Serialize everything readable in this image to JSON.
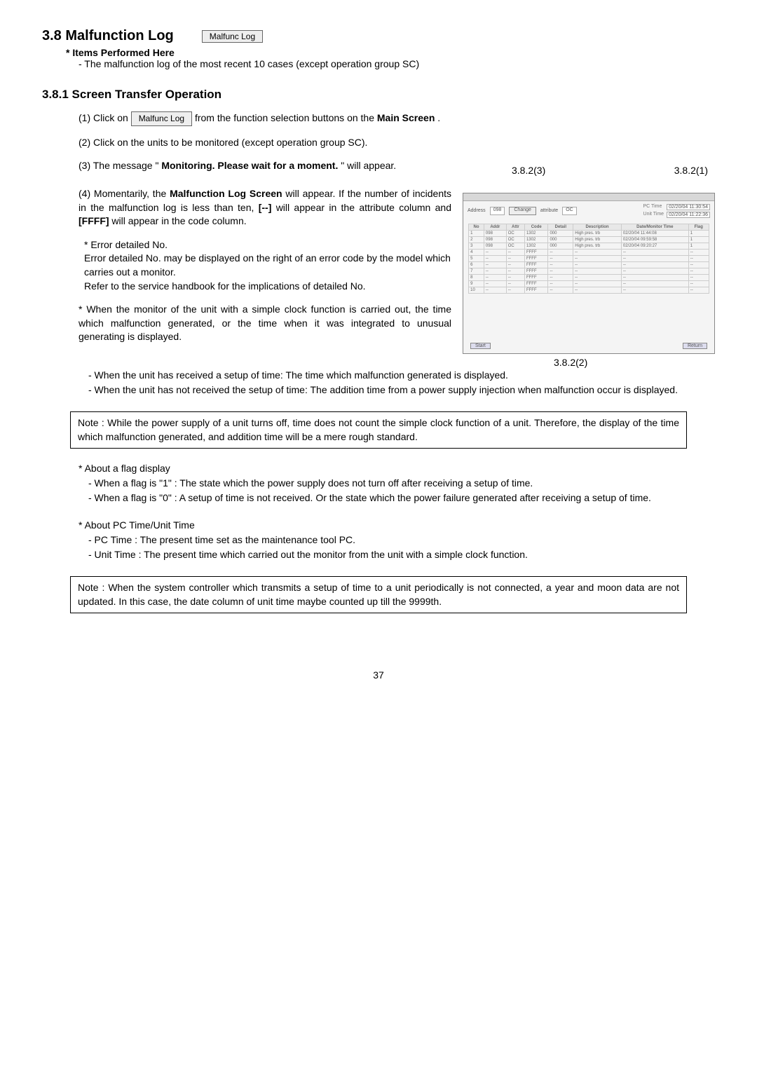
{
  "heading": "3.8 Malfunction Log",
  "button_label": "Malfunc Log",
  "items_performed": "* Items Performed Here",
  "items_performed_line": "- The malfunction log of the most recent 10 cases (except operation group SC)",
  "subheading": "3.8.1 Screen Transfer Operation",
  "step1_prefix": "(1)  Click on ",
  "step1_btn": "Malfunc Log",
  "step1_suffix_a": " from the function selection buttons on the ",
  "step1_bold": "Main Screen",
  "step1_suffix_b": ".",
  "step2": "(2)  Click on the units to be monitored (except operation group SC).",
  "step3_a": "(3)  The message \"",
  "step3_bold": "Monitoring. Please wait for a moment.",
  "step3_b": "\" will appear.",
  "step4_a": "(4)  Momentarily, the ",
  "step4_bold": "Malfunction Log Screen",
  "step4_b": " will appear. If the number of incidents in the malfunction log is less than ten, ",
  "step4_c": "[--]",
  "step4_d": " will appear in the attribute column and ",
  "step4_e": "[FFFF]",
  "step4_f": " will appear in the code column.",
  "err_title": "* Error detailed No.",
  "err_body": "Error detailed No. may be displayed on the right of an error code by the model which carries out a monitor.\nRefer to the service handbook for the implications of detailed No.",
  "clock_note": "* When the monitor of the unit with a simple clock function is carried out, the time which malfunction generated, or the time when it was integrated to unusual generating is displayed.",
  "callout_1": "3.8.2(1)",
  "callout_2": "3.8.2(2)",
  "callout_3": "3.8.2(3)",
  "screenshot": {
    "address_lbl": "Address",
    "address_val": "098",
    "change_btn": "Change",
    "attribute_lbl": "attribute",
    "attribute_val": "OC",
    "pc_time_lbl": "PC Time",
    "pc_time_val": "02/20/04 11:30:54",
    "unit_time_lbl": "Unit Time",
    "unit_time_val": "02/20/04 11:22:36",
    "start_btn": "Start",
    "return_btn": "Return",
    "columns": [
      "No",
      "Addr",
      "Attr",
      "Code",
      "Detail",
      "Description",
      "Date/Monitor Time",
      "Flag"
    ],
    "rows": [
      {
        "no": "1",
        "addr": "098",
        "attr": "OC",
        "code": "1302",
        "detail": "000",
        "desc": "High pres. trb",
        "date": "02/20/04 11:44:08",
        "flag": "1"
      },
      {
        "no": "2",
        "addr": "098",
        "attr": "OC",
        "code": "1302",
        "detail": "000",
        "desc": "High pres. trb",
        "date": "02/20/04 09:59:58",
        "flag": "1"
      },
      {
        "no": "3",
        "addr": "098",
        "attr": "OC",
        "code": "1302",
        "detail": "000",
        "desc": "High pres. trb",
        "date": "02/20/04 09:20:27",
        "flag": "1"
      },
      {
        "no": "4",
        "addr": "--",
        "attr": "--",
        "code": "FFFF",
        "detail": "--",
        "desc": "--",
        "date": "--",
        "flag": "--"
      },
      {
        "no": "5",
        "addr": "--",
        "attr": "--",
        "code": "FFFF",
        "detail": "--",
        "desc": "--",
        "date": "--",
        "flag": "--"
      },
      {
        "no": "6",
        "addr": "--",
        "attr": "--",
        "code": "FFFF",
        "detail": "--",
        "desc": "--",
        "date": "--",
        "flag": "--"
      },
      {
        "no": "7",
        "addr": "--",
        "attr": "--",
        "code": "FFFF",
        "detail": "--",
        "desc": "--",
        "date": "--",
        "flag": "--"
      },
      {
        "no": "8",
        "addr": "--",
        "attr": "--",
        "code": "FFFF",
        "detail": "--",
        "desc": "--",
        "date": "--",
        "flag": "--"
      },
      {
        "no": "9",
        "addr": "--",
        "attr": "--",
        "code": "FFFF",
        "detail": "--",
        "desc": "--",
        "date": "--",
        "flag": "--"
      },
      {
        "no": "10",
        "addr": "--",
        "attr": "--",
        "code": "FFFF",
        "detail": "--",
        "desc": "--",
        "date": "--",
        "flag": "--"
      }
    ]
  },
  "time_bullet_1": "- When the unit has received a setup of time: The time which malfunction generated is displayed.",
  "time_bullet_2": "- When the unit has not received the setup of time: The addition time from a power supply injection when malfunction occur is displayed.",
  "note1": "Note : While the power supply of a unit turns off, time does not count the simple clock function of a unit. Therefore, the display of the time which malfunction generated, and addition time will be a mere rough standard.",
  "flag_title": "* About a flag display",
  "flag_1": "- When a flag is \"1\" : The state which the power supply does not turn off after receiving a setup of time.",
  "flag_0": "- When a flag is \"0\" : A setup of time is not received. Or the state which the power failure generated after receiving a setup of time.",
  "time_title": "* About PC Time/Unit Time",
  "pc_time_desc": "- PC Time : The present time set as the maintenance tool PC.",
  "unit_time_desc": "- Unit Time : The present time which carried out the monitor from the unit with a simple clock function.",
  "note2": "Note : When the system controller which transmits a setup of time to a unit periodically is not connected, a year and moon data are not updated. In this case, the date column of unit time maybe counted up till the 9999th.",
  "pagenum": "37"
}
